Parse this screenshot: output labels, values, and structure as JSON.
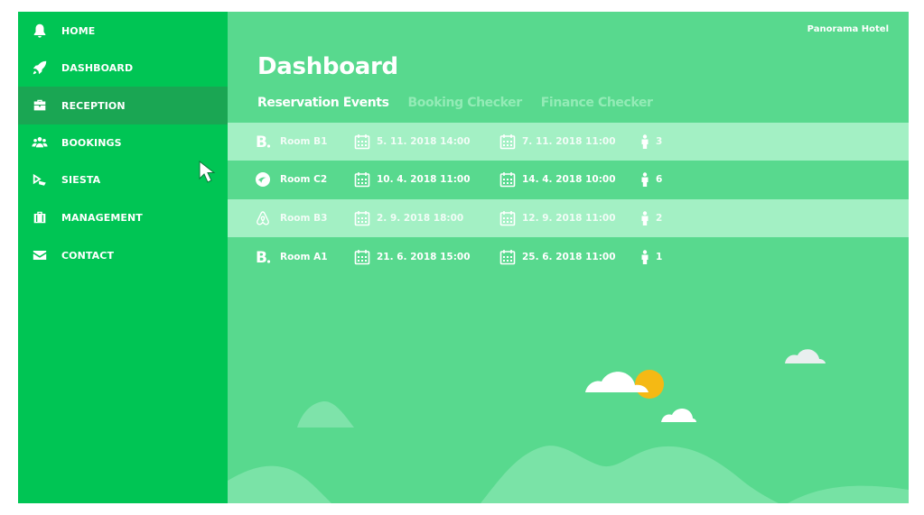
{
  "sidebar": {
    "items": [
      {
        "label": "HOME",
        "icon": "bell-icon"
      },
      {
        "label": "DASHBOARD",
        "icon": "rocket-icon"
      },
      {
        "label": "RECEPTION",
        "icon": "briefcase-icon",
        "active": true
      },
      {
        "label": "BOOKINGS",
        "icon": "users-icon"
      },
      {
        "label": "SIESTA",
        "icon": "siesta-icon"
      },
      {
        "label": "MANAGEMENT",
        "icon": "suitcase-icon"
      },
      {
        "label": "CONTACT",
        "icon": "envelope-icon"
      }
    ]
  },
  "header": {
    "hotel_name": "Panorama Hotel",
    "title": "Dashboard"
  },
  "tabs": [
    {
      "label": "Reservation Events",
      "active": true
    },
    {
      "label": "Booking Checker",
      "active": false
    },
    {
      "label": "Finance Checker",
      "active": false
    }
  ],
  "reservations": [
    {
      "source": "booking-icon",
      "room": "Room B1",
      "checkin": "5. 11. 2018 14:00",
      "checkout": "7. 11. 2018 11:00",
      "guests": "3"
    },
    {
      "source": "expedia-icon",
      "room": "Room C2",
      "checkin": "10. 4. 2018 11:00",
      "checkout": "14. 4. 2018 10:00",
      "guests": "6"
    },
    {
      "source": "airbnb-icon",
      "room": "Room B3",
      "checkin": "2. 9. 2018 18:00",
      "checkout": "12. 9. 2018 11:00",
      "guests": "2"
    },
    {
      "source": "booking-icon",
      "room": "Room A1",
      "checkin": "21. 6. 2018 15:00",
      "checkout": "25. 6. 2018 11:00",
      "guests": "1"
    }
  ],
  "colors": {
    "sidebar": "#00c554",
    "sidebar_active": "#1aa653",
    "main": "#58d98e",
    "row_highlight": "#a3f0c4",
    "sun": "#f5b914"
  }
}
